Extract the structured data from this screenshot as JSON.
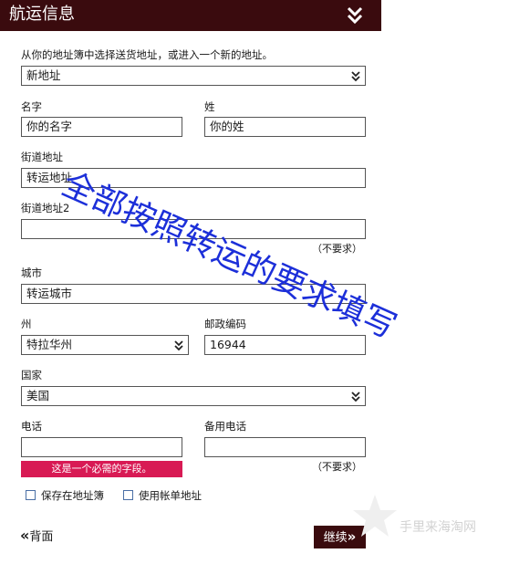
{
  "header": {
    "title": "航运信息"
  },
  "intro": "从你的地址簿中选择送货地址，或进入一个新的地址。",
  "address_select": {
    "value": "新地址"
  },
  "first_name": {
    "label": "名字",
    "value": "你的名字"
  },
  "last_name": {
    "label": "姓",
    "value": "你的姓"
  },
  "street1": {
    "label": "街道地址",
    "value": "转运地址"
  },
  "street2": {
    "label": "街道地址2",
    "value": "",
    "optional": "（不要求）"
  },
  "city": {
    "label": "城市",
    "value": "转运城市"
  },
  "state": {
    "label": "州",
    "value": "特拉华州"
  },
  "zip": {
    "label": "邮政编码",
    "value": "16944"
  },
  "country": {
    "label": "国家",
    "value": "美国"
  },
  "phone": {
    "label": "电话",
    "value": "",
    "error": "这是一个必需的字段。"
  },
  "alt_phone": {
    "label": "备用电话",
    "value": "",
    "optional": "（不要求）"
  },
  "checkboxes": {
    "save": "保存在地址簿",
    "billing": "使用帐单地址"
  },
  "nav": {
    "back": "背面",
    "continue": "继续"
  },
  "overlay_text": "全部按照转运的要求填写",
  "watermark": "手里来海淘网",
  "colors": {
    "header_bg": "#3a0b0e",
    "error_bg": "#d81a54",
    "overlay": "#1c2fd9"
  }
}
